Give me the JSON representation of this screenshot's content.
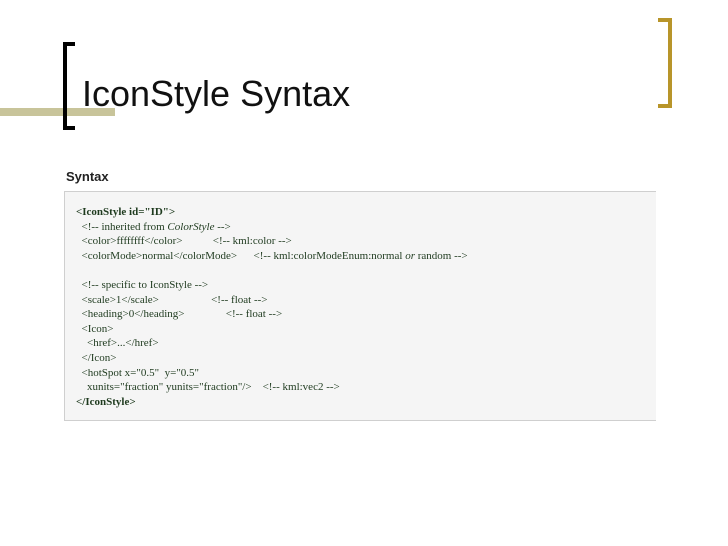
{
  "slide": {
    "title": "IconStyle Syntax"
  },
  "section": {
    "heading": "Syntax"
  },
  "code": {
    "open_tag": "<IconStyle id=\"ID\">",
    "inherited_comment_prefix": "  <!-- inherited from ",
    "inherited_comment_name": "ColorStyle",
    "inherited_comment_suffix": " -->",
    "color_line": "  <color>ffffffff</color>           <!-- kml:color -->",
    "colormode_line_prefix": "  <colorMode>normal</colorMode>      <!-- kml:colorModeEnum:normal ",
    "colormode_line_or": "or",
    "colormode_line_suffix": " random -->",
    "blank": " ",
    "specific_comment": "  <!-- specific to IconStyle -->",
    "scale_line": "  <scale>1</scale>                   <!-- float -->",
    "heading_line": "  <heading>0</heading>               <!-- float -->",
    "icon_open": "  <Icon>",
    "href_line": "    <href>...</href>",
    "icon_close": "  </Icon>",
    "hotspot_line": "  <hotSpot x=\"0.5\"  y=\"0.5\"",
    "units_line": "    xunits=\"fraction\" yunits=\"fraction\"/>    <!-- kml:vec2 -->",
    "close_tag": "</IconStyle>"
  }
}
